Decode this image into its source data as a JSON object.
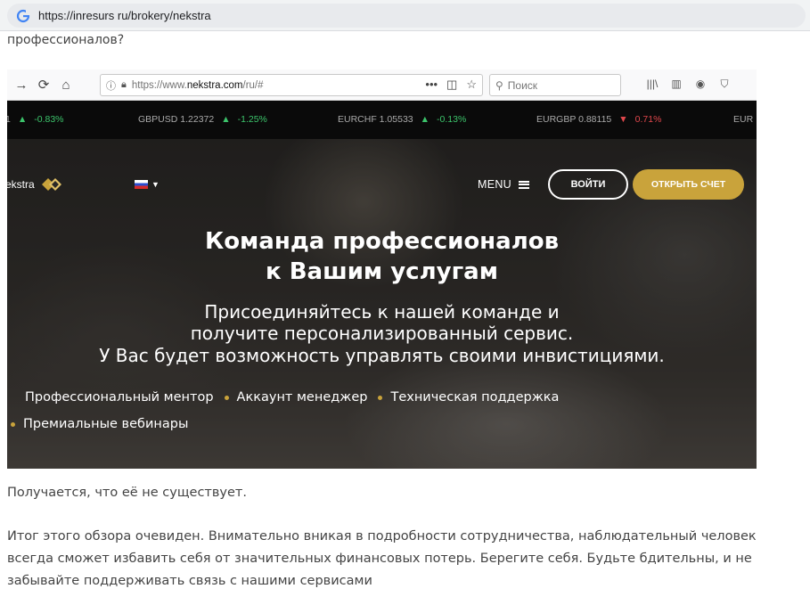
{
  "outer_browser": {
    "url": "https://inresurs ru/brokery/nekstra"
  },
  "article": {
    "prev_text": "профессионалов?",
    "para1": "Получается, что её не существует.",
    "para2_lines": [
      "Итог этого обзора очевиден. Внимательно вникая в подробности сотрудничества, наблюдательный человек",
      "всегда сможет избавить себя от значительных финансовых потерь. Берегите себя. Будьте бдительны, и не",
      "забывайте поддерживать связь с нашими сервисами"
    ]
  },
  "inner_browser": {
    "url_gray": "https://www.",
    "url_bold": "nekstra.com",
    "url_tail": "/ru/#",
    "search_placeholder": "Поиск"
  },
  "ticker": [
    {
      "pair": "1",
      "arrow": "▲",
      "change": "-0.83%",
      "dir": "up"
    },
    {
      "pair": "GBPUSD 1.22372",
      "arrow": "▲",
      "change": "-1.25%",
      "dir": "up"
    },
    {
      "pair": "EURCHF 1.05533",
      "arrow": "▲",
      "change": "-0.13%",
      "dir": "up"
    },
    {
      "pair": "EURGBP 0.88115",
      "arrow": "▼",
      "change": "0.71%",
      "dir": "down"
    },
    {
      "pair": "EUR",
      "arrow": "",
      "change": "",
      "dir": ""
    }
  ],
  "site": {
    "logo_text": "ekstra",
    "menu_label": "MENU",
    "login_label": "ВОЙТИ",
    "open_account_label": "ОТКРЫТЬ СЧЕТ",
    "headline_1": "Команда профессионалов",
    "headline_2": "к Вашим услугам",
    "sub_1": "Присоединяйтесь к нашей команде и",
    "sub_2": "получите персонализированный сервис.",
    "sub_3": "У Вас будет возможность управлять своими инвистициями.",
    "features": [
      "Профессиональный ментор",
      "Аккаунт менеджер",
      "Техническая поддержка",
      "Премиальные вебинары"
    ]
  },
  "colors": {
    "gold": "#c9a33b",
    "up": "#3cc46b",
    "down": "#e0474c"
  }
}
